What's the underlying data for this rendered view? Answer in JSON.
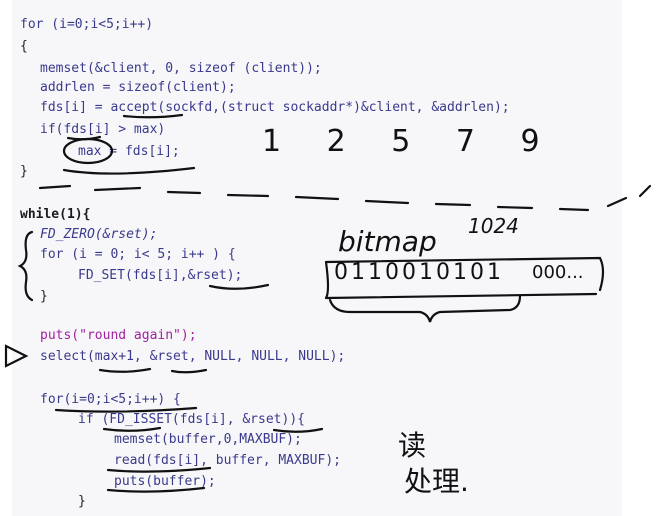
{
  "code_top": {
    "l1": "for (i=0;i<5;i++)",
    "l2": "{",
    "l3": "memset(&client, 0, sizeof (client));",
    "l4": "addrlen = sizeof(client);",
    "l5": "fds[i] = accept(sockfd,(struct sockaddr*)&client, &addrlen);",
    "l6": "if(fds[i] > max)",
    "l7": "max = fds[i];",
    "l8": "}"
  },
  "code_bottom": {
    "l1": "while(1){",
    "l2": "FD_ZERO(&rset);",
    "l3": "for (i = 0; i< 5; i++ ) {",
    "l4": "FD_SET(fds[i],&rset);",
    "l5": "}",
    "l6": "puts(\"round again\");",
    "l7": "select(max+1, &rset, NULL, NULL, NULL);",
    "l8": "for(i=0;i<5;i++) {",
    "l9": "if (FD_ISSET(fds[i], &rset)){",
    "l10": "memset(buffer,0,MAXBUF);",
    "l11": "read(fds[i], buffer, MAXBUF);",
    "l12": "puts(buffer);",
    "l13": "}"
  },
  "annotations": {
    "numbers": "1 2 5 7 9",
    "bitmap_label": "bitmap",
    "bitmap_size": "1024",
    "bits": "0110010101",
    "bits_tail": "000...",
    "note_read": "读",
    "note_process": "处理."
  }
}
